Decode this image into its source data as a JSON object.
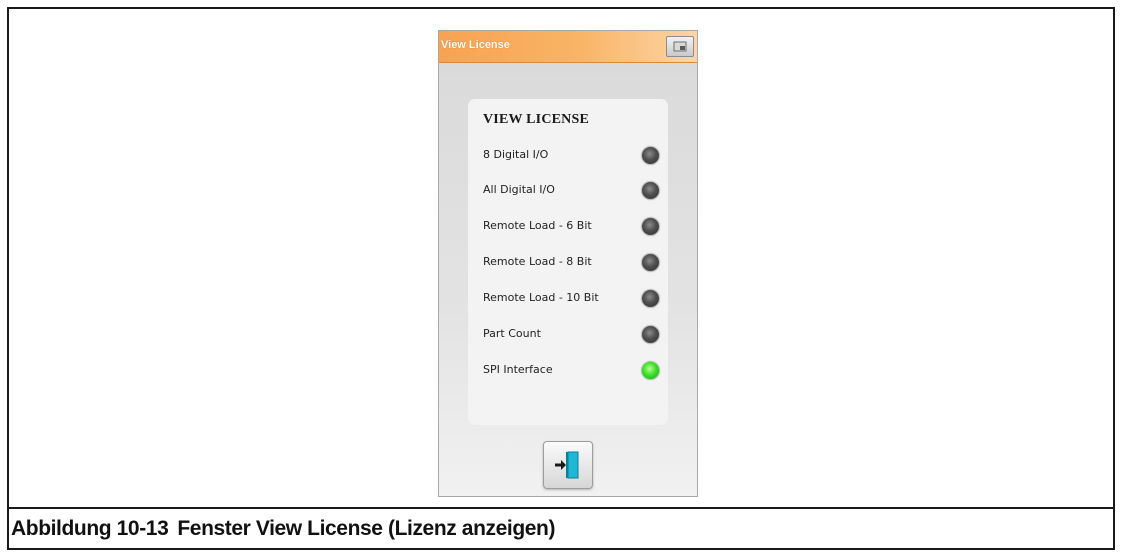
{
  "window": {
    "title": "View License"
  },
  "panel": {
    "heading": "VIEW LICENSE",
    "items": [
      {
        "label": "8 Digital I/O",
        "status": "off"
      },
      {
        "label": "All Digital I/O",
        "status": "off"
      },
      {
        "label": "Remote Load - 6 Bit",
        "status": "off"
      },
      {
        "label": "Remote Load - 8 Bit",
        "status": "off"
      },
      {
        "label": "Remote Load - 10 Bit",
        "status": "off"
      },
      {
        "label": "Part Count",
        "status": "off"
      },
      {
        "label": "SPI Interface",
        "status": "on"
      }
    ]
  },
  "buttons": {
    "exit_icon": "exit-door-icon",
    "titlebar_icon": "window-restore-icon"
  },
  "caption": {
    "number": "Abbildung 10-13",
    "text": "Fenster View License (Lizenz anzeigen)"
  },
  "colors": {
    "titlebar_accent": "#f7a351",
    "led_off": "#4f4f4f",
    "led_on": "#3ee02b"
  }
}
